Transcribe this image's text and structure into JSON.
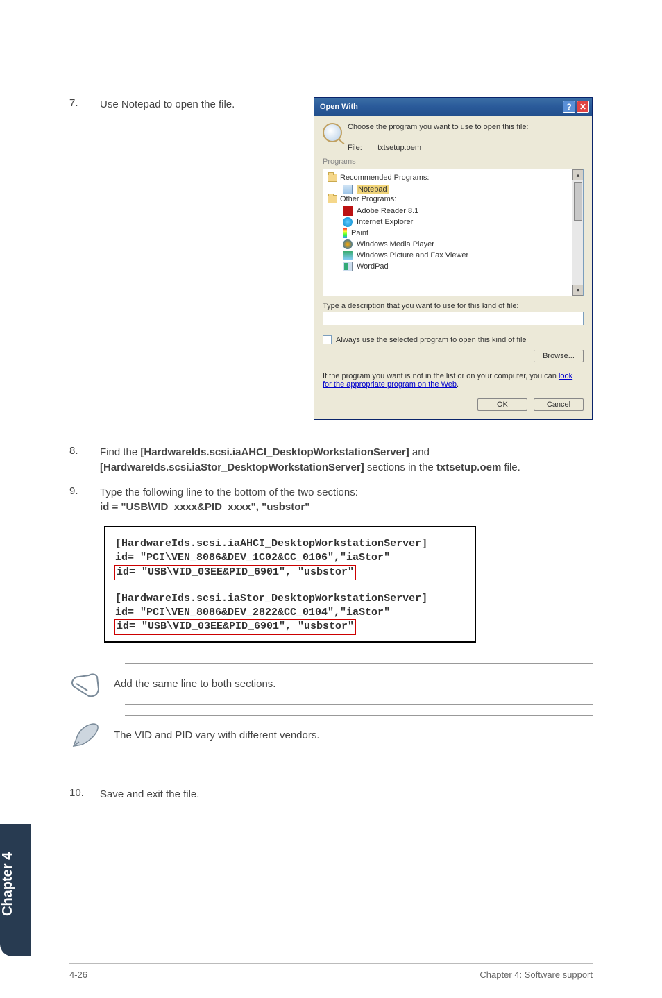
{
  "steps": {
    "s7": {
      "num": "7.",
      "text": "Use Notepad to open the file."
    },
    "s8": {
      "num": "8.",
      "pre": "Find the ",
      "b1": "[HardwareIds.scsi.iaAHCI_DesktopWorkstationServer]",
      "mid": " and ",
      "b2": "[HardwareIds.scsi.iaStor_DesktopWorkstationServer]",
      "mid2": " sections in the ",
      "b3": "txtsetup.oem",
      "post": " file."
    },
    "s9": {
      "num": "9.",
      "line1": "Type the following line to the bottom of the two sections:",
      "line2": "id = \"USB\\VID_xxxx&PID_xxxx\", \"usbstor\""
    },
    "s10": {
      "num": "10.",
      "text": "Save and exit the file."
    }
  },
  "dialog": {
    "title": "Open With",
    "choose": "Choose the program you want to use to open this file:",
    "file_label": "File:",
    "file_name": "txtsetup.oem",
    "section": "Programs",
    "group_rec": "Recommended Programs:",
    "group_other": "Other Programs:",
    "items": {
      "notepad": "Notepad",
      "adobe": "Adobe Reader 8.1",
      "ie": "Internet Explorer",
      "paint": "Paint",
      "wmp": "Windows Media Player",
      "wpfv": "Windows Picture and Fax Viewer",
      "wordpad": "WordPad"
    },
    "type_hint": "Type a description that you want to use for this kind of file:",
    "always": "Always use the selected program to open this kind of file",
    "browse": "Browse...",
    "weblink_pre": "If the program you want is not in the list or on your computer, you can ",
    "weblink_link": "look for the appropriate program on the Web",
    "weblink_post": ".",
    "ok": "OK",
    "cancel": "Cancel"
  },
  "code": {
    "l1": "[HardwareIds.scsi.iaAHCI_DesktopWorkstationServer]",
    "l2": "id= \"PCI\\VEN_8086&DEV_1C02&CC_0106\",\"iaStor\"",
    "l3": "id= \"USB\\VID_03EE&PID_6901\", \"usbstor\"",
    "l4": "[HardwareIds.scsi.iaStor_DesktopWorkstationServer]",
    "l5": "id= \"PCI\\VEN_8086&DEV_2822&CC_0104\",\"iaStor\"",
    "l6": "id= \"USB\\VID_03EE&PID_6901\", \"usbstor\""
  },
  "notes": {
    "n1": "Add the same line to both sections.",
    "n2": "The VID and PID vary with different vendors."
  },
  "sidetab": "Chapter 4",
  "footer": {
    "left": "4-26",
    "right": "Chapter 4: Software support"
  }
}
